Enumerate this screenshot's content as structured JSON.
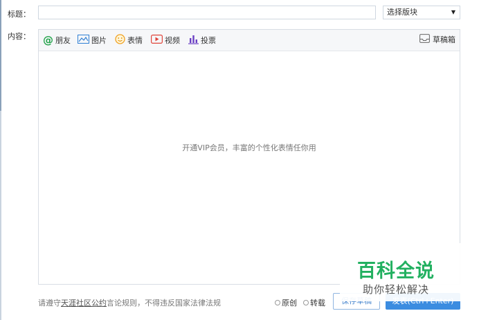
{
  "form": {
    "title_label": "标题：",
    "content_label": "内容：",
    "title_value": "",
    "board_select": "选择版块"
  },
  "toolbar": {
    "friends": "朋友",
    "images": "图片",
    "emoji": "表情",
    "video": "视频",
    "vote": "投票",
    "drafts": "草稿箱"
  },
  "editor": {
    "hint": "开通VIP会员，丰富的个性化表情任你用"
  },
  "footer": {
    "rules_prefix": "请遵守",
    "rules_link": "天涯社区公约",
    "rules_suffix": "言论规则，不得违反国家法律法规",
    "original": "原创",
    "repost": "转载",
    "save_draft": "保存草稿",
    "post": "发表(Ctrl+Enter)"
  },
  "watermark": {
    "title": "百科全说",
    "subtitle": "助你轻松解决"
  },
  "colors": {
    "accent_blue": "#3b8ce0",
    "watermark_green": "#22b060",
    "icon_orange": "#f0a020",
    "icon_red": "#e0443a",
    "icon_purple": "#6a3fc4"
  }
}
